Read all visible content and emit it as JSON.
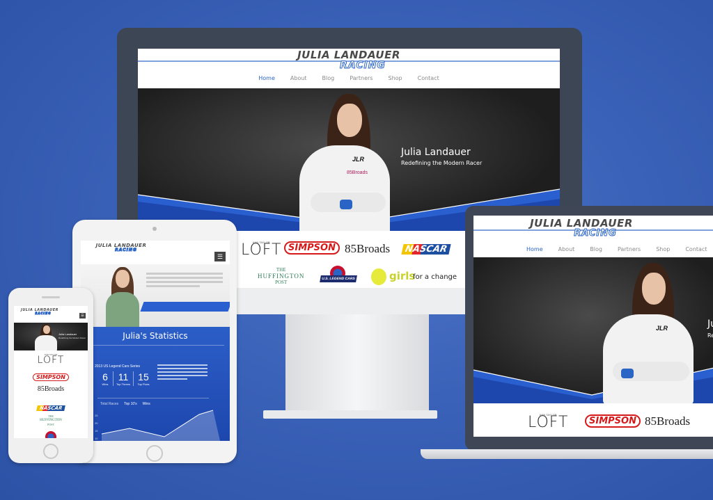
{
  "site": {
    "logo_line1": "JULIA LANDAUER",
    "logo_line2": "RACING",
    "nav": [
      "Home",
      "About",
      "Blog",
      "Partners",
      "Shop",
      "Contact"
    ],
    "hero_title": "Julia Landauer",
    "hero_subtitle": "Redefining the Modern Racer",
    "hero_title_cropped": "Jul",
    "hero_subtitle_cropped": "Rede"
  },
  "sponsors": {
    "loft_small": "ANN TAYLOR",
    "loft": "LOFT",
    "simpson": "SIMPSON",
    "broads": "85Broads",
    "nascar": "NASCAR",
    "huff_the": "THE",
    "huff_name": "HUFFINGTON",
    "huff_post": "POST",
    "legend": "U.S. LEGEND CARS",
    "girls": "girls",
    "girls_tail": "for a change"
  },
  "tablet": {
    "stats_title": "Julia's Statistics",
    "series": "2013 US Legend Cars Series",
    "stats": [
      {
        "value": "6",
        "label": "Wins"
      },
      {
        "value": "11",
        "label": "Top Threes"
      },
      {
        "value": "15",
        "label": "Top Fives"
      }
    ],
    "tabs": [
      "Total Races",
      "Top 10's",
      "Wins"
    ],
    "axis": [
      "25",
      "20",
      "15",
      "10"
    ]
  },
  "colors": {
    "accent": "#2a64c4",
    "background": "#3a62b8",
    "frame": "#3d4654"
  },
  "icons": [
    "menu-icon",
    "home-button-icon"
  ]
}
